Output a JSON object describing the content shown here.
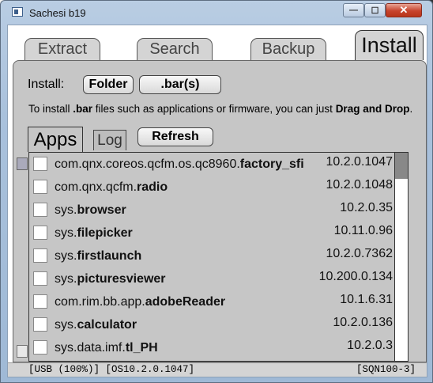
{
  "window": {
    "title": "Sachesi b19",
    "min_glyph": "—",
    "max_glyph": "☐",
    "close_glyph": "✕"
  },
  "tabs": {
    "extract": "Extract",
    "search": "Search",
    "backup": "Backup",
    "install": "Install"
  },
  "install": {
    "label": "Install:",
    "folder_button": "Folder",
    "bars_button": ".bar(s)",
    "hint": {
      "p1": "To install ",
      "b1": ".bar",
      "p2": " files such as applications or firmware, you can just ",
      "b2": "Drag and Drop",
      "p3": "."
    }
  },
  "subtabs": {
    "apps": "Apps",
    "log": "Log"
  },
  "refresh_button": "Refresh",
  "apps": [
    {
      "prefix": "com.qnx.coreos.qcfm.os.qc8960.",
      "name": "factory_sfi",
      "version": "10.2.0.1047"
    },
    {
      "prefix": "com.qnx.qcfm.",
      "name": "radio",
      "version": "10.2.0.1048"
    },
    {
      "prefix": "sys.",
      "name": "browser",
      "version": "10.2.0.35"
    },
    {
      "prefix": "sys.",
      "name": "filepicker",
      "version": "10.11.0.96"
    },
    {
      "prefix": "sys.",
      "name": "firstlaunch",
      "version": "10.2.0.7362"
    },
    {
      "prefix": "sys.",
      "name": "picturesviewer",
      "version": "10.200.0.134"
    },
    {
      "prefix": "com.rim.bb.app.",
      "name": "adobeReader",
      "version": "10.1.6.31"
    },
    {
      "prefix": "sys.",
      "name": "calculator",
      "version": "10.2.0.136"
    },
    {
      "prefix": "sys.data.imf.",
      "name": "tl_PH",
      "version": "10.2.0.3"
    }
  ],
  "scrollbar": {
    "position_fraction": 0.0
  },
  "status": {
    "left": "[USB (100%)] [OS10.2.0.1047]",
    "right": "[SQN100-3]"
  }
}
